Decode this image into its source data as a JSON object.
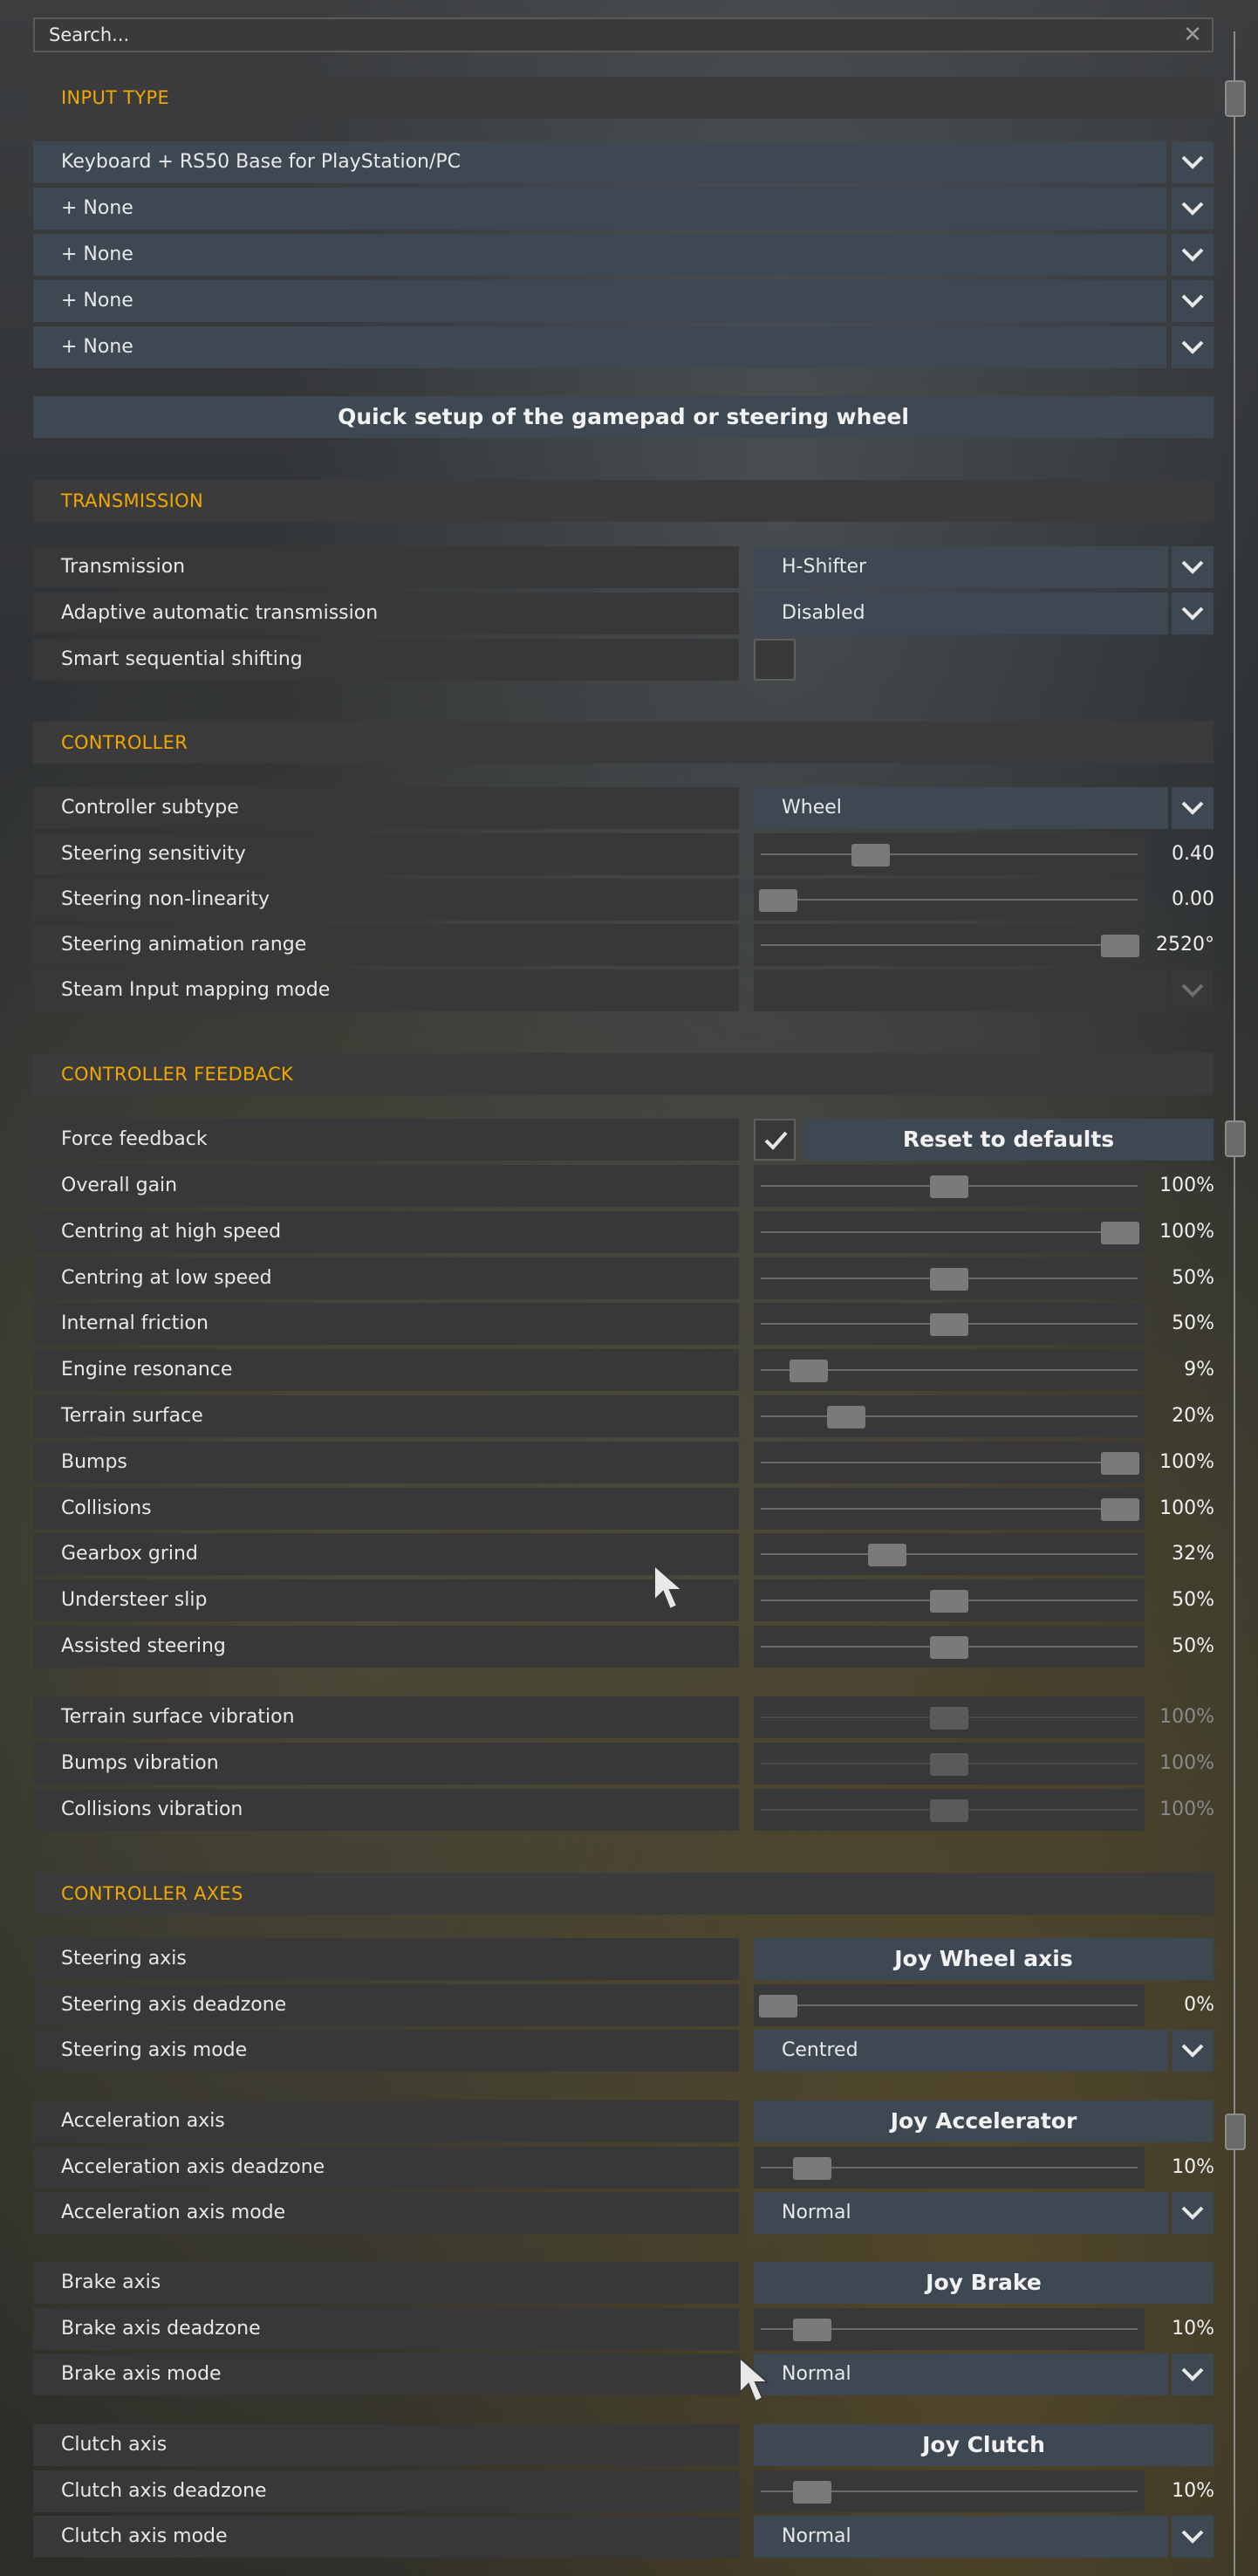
{
  "search": {
    "placeholder": "Search..."
  },
  "input_type": {
    "title": "INPUT TYPE",
    "devices": [
      "Keyboard + RS50 Base for PlayStation/PC",
      "+ None",
      "+ None",
      "+ None",
      "+ None"
    ],
    "quick_setup_label": "Quick setup of the gamepad or steering wheel"
  },
  "transmission": {
    "title": "TRANSMISSION",
    "transmission_label": "Transmission",
    "transmission_value": "H-Shifter",
    "adaptive_label": "Adaptive automatic transmission",
    "adaptive_value": "Disabled",
    "smart_label": "Smart sequential shifting",
    "smart_checked": false
  },
  "controller": {
    "title": "CONTROLLER",
    "subtype_label": "Controller subtype",
    "subtype_value": "Wheel",
    "sliders": [
      {
        "label": "Steering sensitivity",
        "value": "0.40",
        "level": 0.27
      },
      {
        "label": "Steering non-linearity",
        "value": "0.00",
        "level": 0.0
      },
      {
        "label": "Steering animation range",
        "value": "2520°",
        "level": 1.0
      }
    ],
    "steam_label": "Steam Input mapping mode"
  },
  "feedback": {
    "title": "CONTROLLER FEEDBACK",
    "force_label": "Force feedback",
    "force_checked": true,
    "reset_label": "Reset to defaults",
    "sliders": [
      {
        "label": "Overall gain",
        "value": "100%",
        "level": 0.5
      },
      {
        "label": "Centring at high speed",
        "value": "100%",
        "level": 1.0
      },
      {
        "label": "Centring at low speed",
        "value": "50%",
        "level": 0.5
      },
      {
        "label": "Internal friction",
        "value": "50%",
        "level": 0.5
      },
      {
        "label": "Engine resonance",
        "value": "9%",
        "level": 0.09
      },
      {
        "label": "Terrain surface",
        "value": "20%",
        "level": 0.2
      },
      {
        "label": "Bumps",
        "value": "100%",
        "level": 1.0
      },
      {
        "label": "Collisions",
        "value": "100%",
        "level": 1.0
      },
      {
        "label": "Gearbox grind",
        "value": "32%",
        "level": 0.32
      },
      {
        "label": "Understeer slip",
        "value": "50%",
        "level": 0.5
      },
      {
        "label": "Assisted steering",
        "value": "50%",
        "level": 0.5
      }
    ],
    "vibration": [
      {
        "label": "Terrain surface vibration",
        "value": "100%",
        "level": 0.5
      },
      {
        "label": "Bumps vibration",
        "value": "100%",
        "level": 0.5
      },
      {
        "label": "Collisions vibration",
        "value": "100%",
        "level": 0.5
      }
    ]
  },
  "axes": {
    "title": "CONTROLLER AXES",
    "groups": [
      {
        "axis_label": "Steering axis",
        "axis_value": "Joy Wheel axis",
        "deadzone_label": "Steering axis deadzone",
        "deadzone_value": "0%",
        "deadzone_level": 0.0,
        "mode_label": "Steering axis mode",
        "mode_value": "Centred"
      },
      {
        "axis_label": "Acceleration axis",
        "axis_value": "Joy Accelerator",
        "deadzone_label": "Acceleration axis deadzone",
        "deadzone_value": "10%",
        "deadzone_level": 0.1,
        "mode_label": "Acceleration axis mode",
        "mode_value": "Normal"
      },
      {
        "axis_label": "Brake axis",
        "axis_value": "Joy Brake",
        "deadzone_label": "Brake axis deadzone",
        "deadzone_value": "10%",
        "deadzone_level": 0.1,
        "mode_label": "Brake axis mode",
        "mode_value": "Normal"
      },
      {
        "axis_label": "Clutch axis",
        "axis_value": "Joy Clutch",
        "deadzone_label": "Clutch axis deadzone",
        "deadzone_value": "10%",
        "deadzone_level": 0.1,
        "mode_label": "Clutch axis mode",
        "mode_value": "Normal"
      }
    ]
  },
  "colors": {
    "accent": "#f0a800",
    "row": "#383838",
    "dropdown": "#3d4852"
  }
}
